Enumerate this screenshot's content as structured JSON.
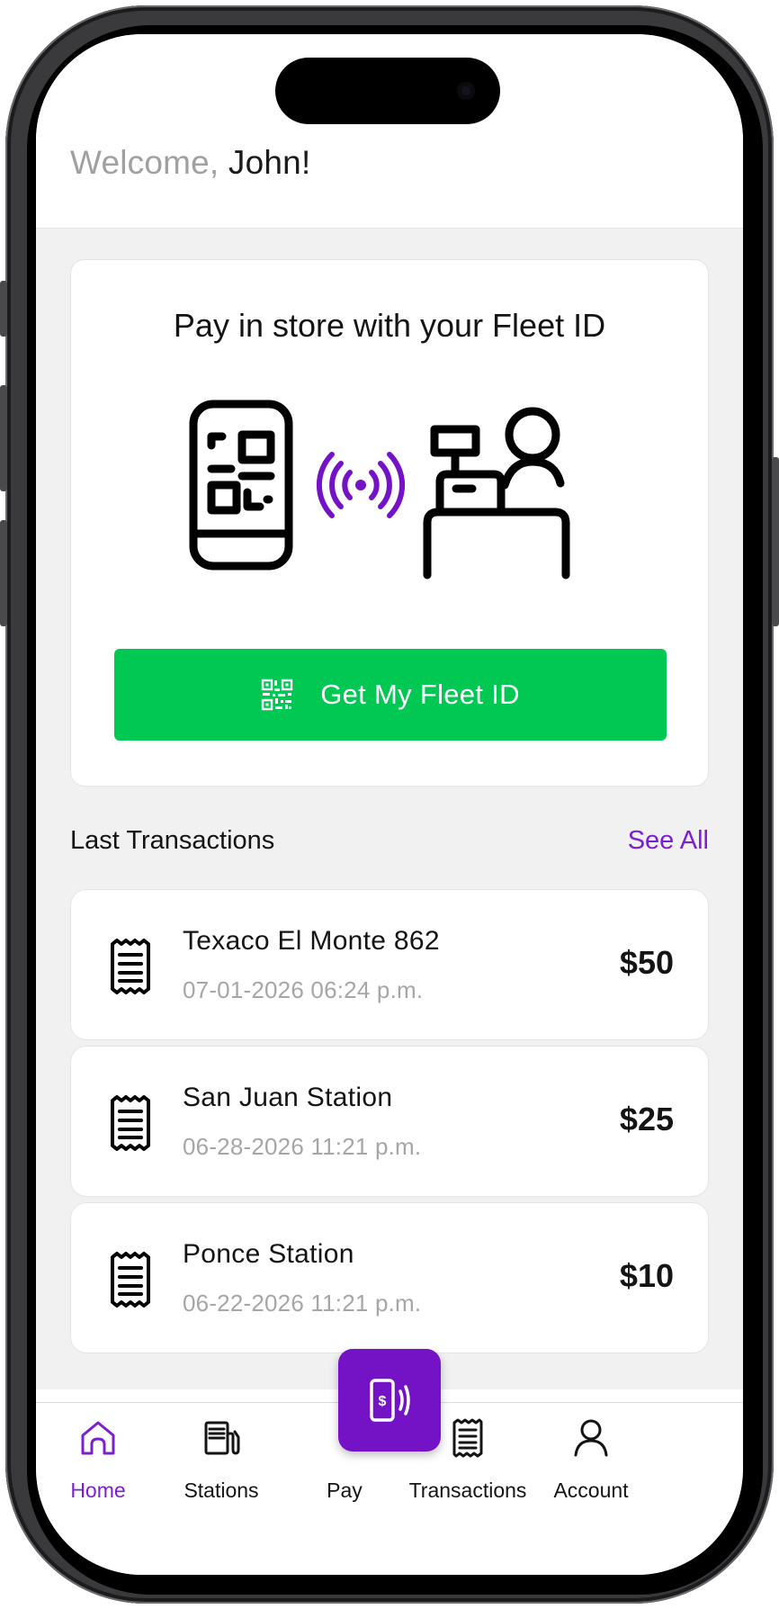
{
  "header": {
    "greeting": "Welcome,",
    "user_name": "John!"
  },
  "pay_card": {
    "title": "Pay in store with your Fleet ID",
    "button_label": "Get My Fleet ID",
    "button_icon": "qr-code-icon",
    "illustration_icons": [
      "phone-qr-icon",
      "nfc-signal-icon",
      "cashier-icon"
    ]
  },
  "transactions": {
    "section_title": "Last Transactions",
    "see_all_label": "See All",
    "items": [
      {
        "name": "Texaco El Monte 862",
        "date": "07-01-2026 06:24 p.m.",
        "amount": "$50",
        "icon": "receipt-icon"
      },
      {
        "name": "San Juan Station",
        "date": "06-28-2026 11:21 p.m.",
        "amount": "$25",
        "icon": "receipt-icon"
      },
      {
        "name": "Ponce Station",
        "date": "06-22-2026 11:21 p.m.",
        "amount": "$10",
        "icon": "receipt-icon"
      }
    ]
  },
  "nav": {
    "items": [
      {
        "label": "Home",
        "icon": "home-icon",
        "active": true
      },
      {
        "label": "Stations",
        "icon": "fuel-pump-icon",
        "active": false
      },
      {
        "label": "Pay",
        "icon": "phone-pay-icon",
        "active": false
      },
      {
        "label": "Transactions",
        "icon": "receipt-icon",
        "active": false
      },
      {
        "label": "Account",
        "icon": "user-icon",
        "active": false
      }
    ]
  },
  "colors": {
    "accent_purple": "#7b1fd1",
    "fab_purple": "#7412c6",
    "button_green": "#00c853",
    "background": "#f1f1f1",
    "muted_text": "#a6a6a6"
  }
}
